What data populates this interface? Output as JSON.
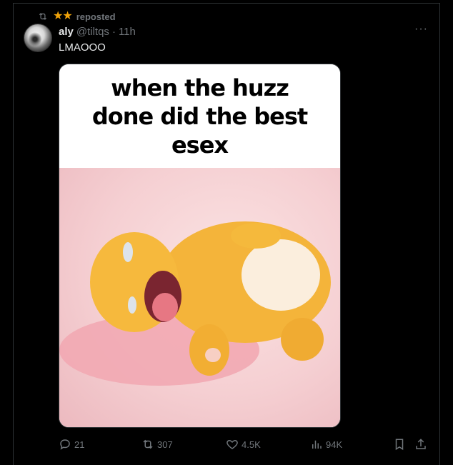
{
  "repost": {
    "stars": "★★",
    "label": "reposted"
  },
  "tweet": {
    "author": "aly",
    "handle": "@tiltqs",
    "separator": "·",
    "time": "11h",
    "text": "LMAOOO",
    "more": "···"
  },
  "media": {
    "caption": "when the huzz done did the best esex"
  },
  "actions": {
    "replies": "21",
    "reposts": "307",
    "likes": "4.5K",
    "views": "94K"
  },
  "colors": {
    "background": "#000000",
    "muted": "#71767b",
    "text": "#e7e9ea",
    "star": "#f0a30a"
  }
}
